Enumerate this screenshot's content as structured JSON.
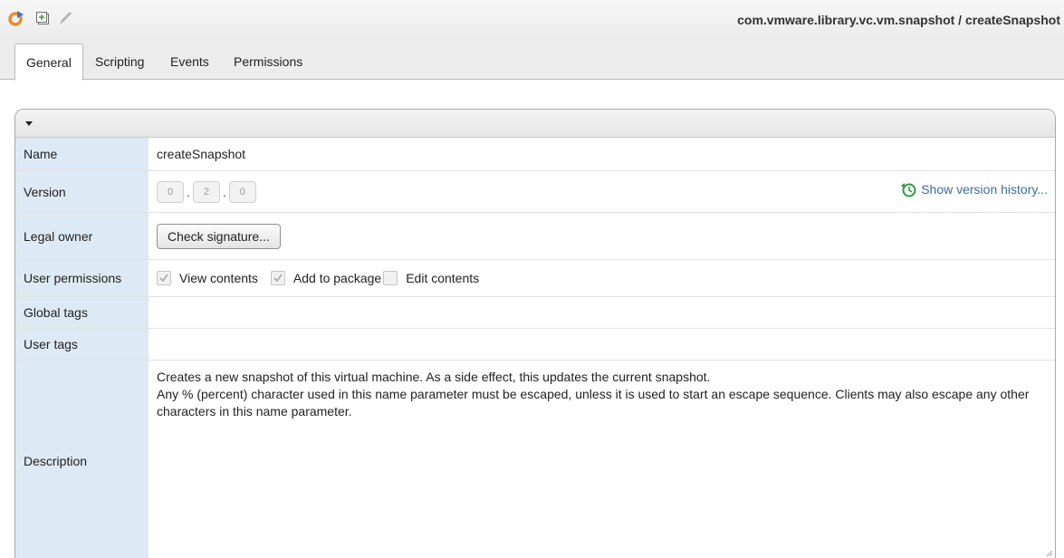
{
  "window": {
    "title": "com.vmware.library.vc.vm.snapshot / createSnapshot"
  },
  "toolbar": {
    "icons": [
      "run-icon",
      "duplicate-icon",
      "edit-pencil-icon"
    ]
  },
  "tabs": [
    {
      "label": "General",
      "active": true
    },
    {
      "label": "Scripting",
      "active": false
    },
    {
      "label": "Events",
      "active": false
    },
    {
      "label": "Permissions",
      "active": false
    }
  ],
  "general": {
    "name": {
      "label": "Name",
      "value": "createSnapshot"
    },
    "version": {
      "label": "Version",
      "major": "0",
      "minor": "2",
      "patch": "0",
      "separator": ".",
      "history_link": "Show version history..."
    },
    "legal_owner": {
      "label": "Legal owner",
      "button": "Check signature..."
    },
    "user_permissions": {
      "label": "User permissions",
      "options": [
        {
          "label": "View contents",
          "checked": true
        },
        {
          "label": "Add to package",
          "checked": true
        },
        {
          "label": "Edit contents",
          "checked": false
        }
      ]
    },
    "global_tags": {
      "label": "Global tags",
      "value": ""
    },
    "user_tags": {
      "label": "User tags",
      "value": ""
    },
    "description": {
      "label": "Description",
      "lines": [
        "Creates a new snapshot of this virtual machine. As a side effect, this updates the current snapshot.",
        "Any % (percent) character used in this name parameter must be escaped, unless it is used to start an escape sequence. Clients may also escape any other characters in this name parameter."
      ]
    }
  },
  "colors": {
    "label_bg": "#dde9f5",
    "link": "#3a6da0",
    "history_icon": "#2e9a3a",
    "run_icon": "#e8902a"
  }
}
